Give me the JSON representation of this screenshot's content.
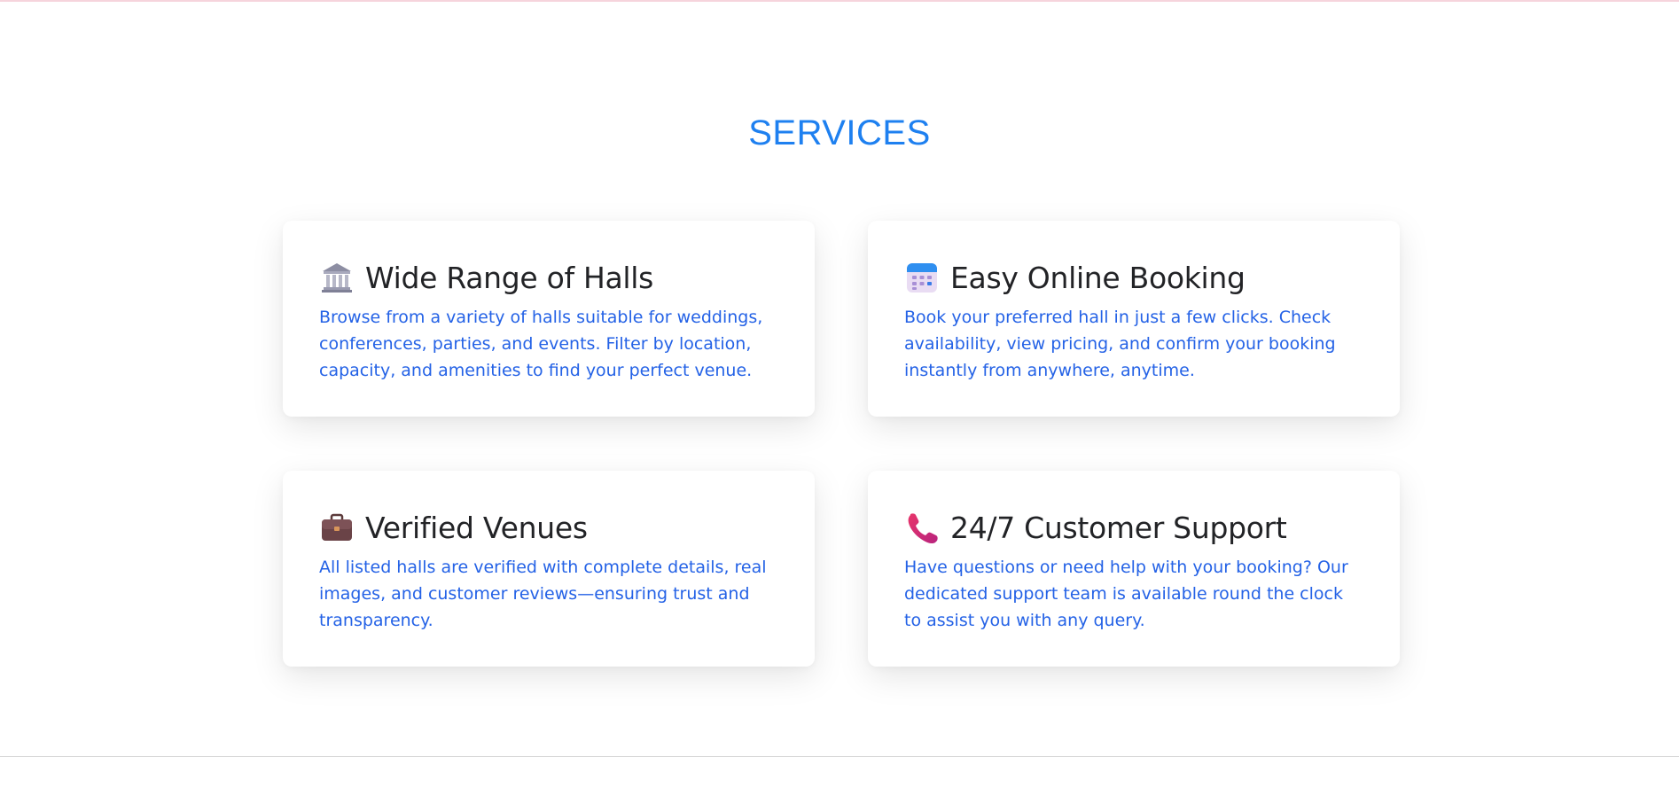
{
  "section": {
    "title": "SERVICES"
  },
  "cards": [
    {
      "icon": "classical-building-icon",
      "title": "Wide Range of Halls",
      "text": "Browse from a variety of halls suitable for weddings, conferences, parties, and events. Filter by location, capacity, and amenities to find your perfect venue."
    },
    {
      "icon": "calendar-icon",
      "title": "Easy Online Booking",
      "text": "Book your preferred hall in just a few clicks. Check availability, view pricing, and confirm your booking instantly from anywhere, anytime."
    },
    {
      "icon": "briefcase-icon",
      "title": "Verified Venues",
      "text": "All listed halls are verified with complete details, real images, and customer reviews—ensuring trust and transparency."
    },
    {
      "icon": "telephone-icon",
      "title": "24/7 Customer Support",
      "text": "Have questions or need help with your booking? Our dedicated support team is available round the clock to assist you with any query."
    }
  ],
  "colors": {
    "accent": "#1e80f0",
    "body_text": "#2462e6",
    "heading": "#222326"
  }
}
